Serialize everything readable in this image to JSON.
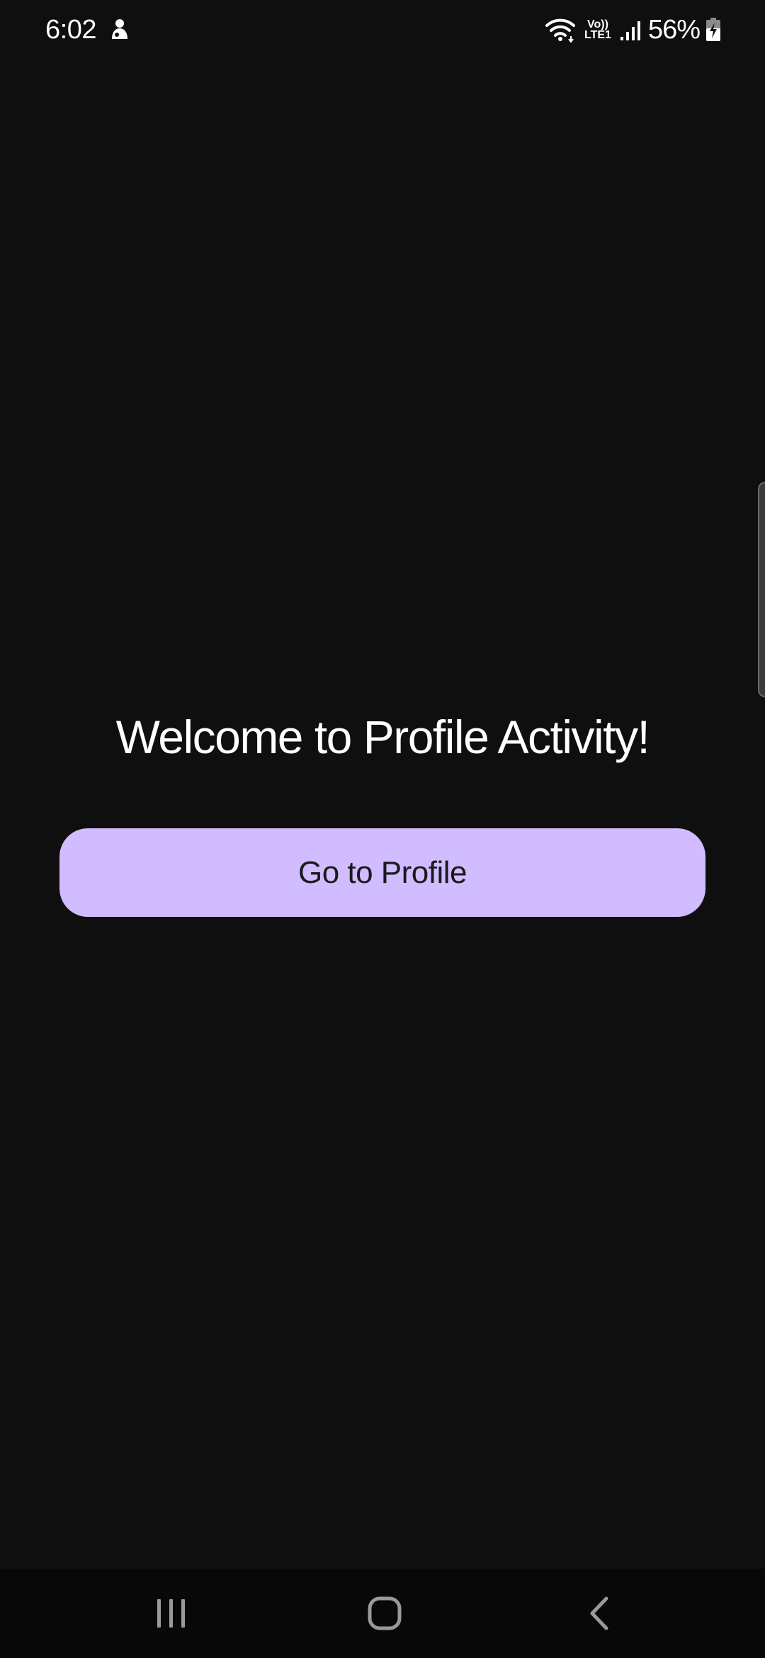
{
  "status_bar": {
    "time": "6:02",
    "net_top": "Vo))",
    "net_bottom": "LTE1",
    "battery": "56%",
    "icons": [
      "notification-icon",
      "wifi-icon",
      "volte-icon",
      "signal-icon",
      "battery-charging-icon"
    ]
  },
  "main": {
    "title": "Welcome to Profile Activity!",
    "button_label": "Go to Profile"
  },
  "nav": {
    "icons": [
      "recents-icon",
      "home-icon",
      "back-icon"
    ]
  },
  "colors": {
    "background": "#0f0f0f",
    "button": "#d0bcff",
    "button_text": "#1a1a1a",
    "nav_background": "#080808"
  }
}
